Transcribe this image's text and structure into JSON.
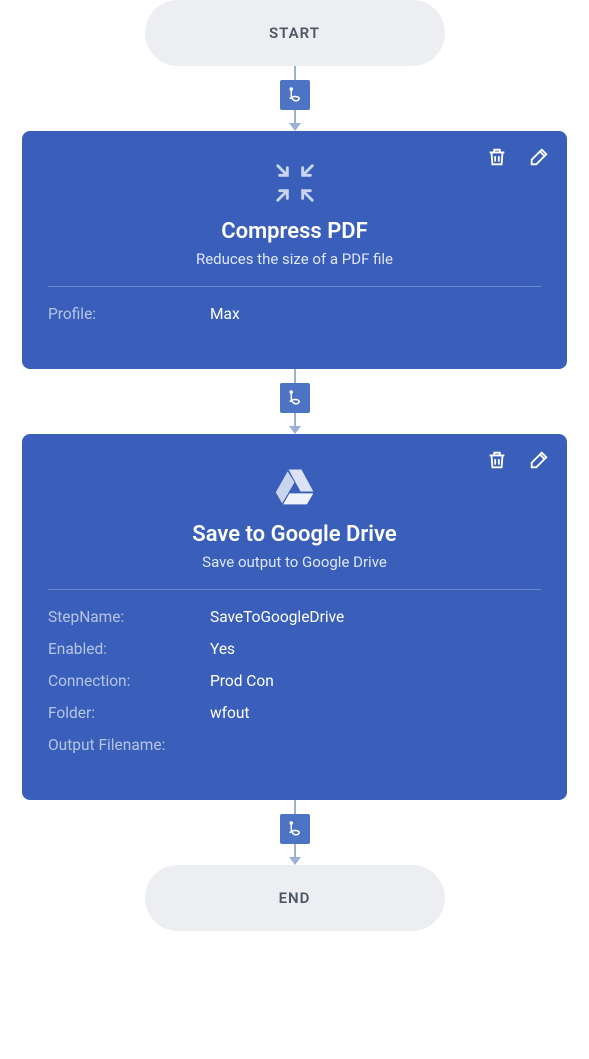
{
  "start": {
    "label": "START"
  },
  "end": {
    "label": "END"
  },
  "badge_icon": "pdf",
  "cards": [
    {
      "icon": "compress",
      "title": "Compress PDF",
      "subtitle": "Reduces the size of a PDF file",
      "properties": [
        {
          "label": "Profile:",
          "value": "Max"
        }
      ]
    },
    {
      "icon": "google-drive",
      "title": "Save to Google Drive",
      "subtitle": "Save output to Google Drive",
      "properties": [
        {
          "label": "StepName:",
          "value": "SaveToGoogleDrive"
        },
        {
          "label": "Enabled:",
          "value": "Yes"
        },
        {
          "label": "Connection:",
          "value": "Prod Con"
        },
        {
          "label": "Folder:",
          "value": "wfout"
        },
        {
          "label": "Output Filename:",
          "value": ""
        }
      ]
    }
  ]
}
